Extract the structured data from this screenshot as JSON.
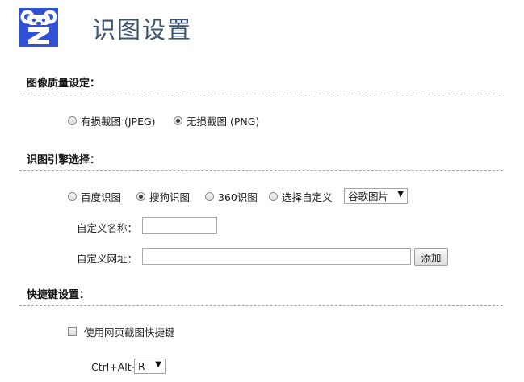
{
  "header": {
    "title": "识图设置",
    "logo_icon": "koala-z-logo-icon"
  },
  "image_quality": {
    "title": "图像质量设定：",
    "options": [
      {
        "label": "有损截图 (JPEG)",
        "checked": false
      },
      {
        "label": "无损截图 (PNG)",
        "checked": true
      }
    ]
  },
  "engine": {
    "title": "识图引擎选择：",
    "options": [
      {
        "label": "百度识图",
        "checked": false
      },
      {
        "label": "搜狗识图",
        "checked": true
      },
      {
        "label": "360识图",
        "checked": false
      },
      {
        "label": "选择自定义",
        "checked": false
      }
    ],
    "preset_select": {
      "value": "谷歌图片"
    },
    "custom_name_label": "自定义名称：",
    "custom_name_value": "",
    "custom_url_label": "自定义网址：",
    "custom_url_value": "",
    "add_button": "添加"
  },
  "shortcut": {
    "title": "快捷键设置：",
    "checkbox_label": "使用网页截图快捷键",
    "checked": false,
    "prefix": "Ctrl+Alt+",
    "key_select": {
      "value": "R"
    }
  },
  "colors": {
    "title": "#3a5370",
    "logo": "#3050d8",
    "divider": "#a8a8a8"
  }
}
